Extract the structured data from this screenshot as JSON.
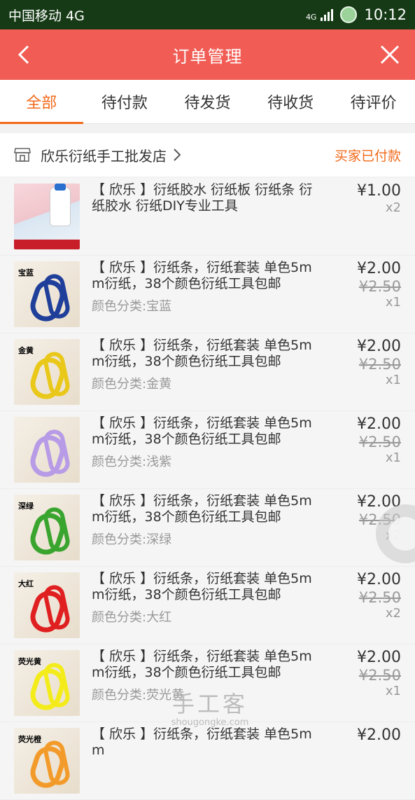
{
  "status_bar": {
    "carrier": "中国移动 4G",
    "network": "4G",
    "time": "10:12"
  },
  "title_bar": {
    "title": "订单管理",
    "back_icon": "chevron-left-icon",
    "close_icon": "close-icon"
  },
  "tabs": [
    {
      "label": "全部",
      "active": true
    },
    {
      "label": "待付款",
      "active": false
    },
    {
      "label": "待发货",
      "active": false
    },
    {
      "label": "待收货",
      "active": false
    },
    {
      "label": "待评价",
      "active": false
    }
  ],
  "shop": {
    "name": "欣乐衍纸手工批发店",
    "status": "买家已付款",
    "icon": "shop-icon"
  },
  "items": [
    {
      "title": "【 欣乐 】衍纸胶水 衍纸板 衍纸条 衍纸胶水 衍纸DIY专业工具",
      "variant": "",
      "price": "¥1.00",
      "old_price": "",
      "qty": "x2",
      "thumb_tag": "",
      "color": "#3b7bd0"
    },
    {
      "title": "【 欣乐 】衍纸条，衍纸套装 单色5mm衍纸，38个颜色衍纸工具包邮",
      "variant": "颜色分类:宝蓝",
      "price": "¥2.00",
      "old_price": "¥2.50",
      "qty": "x1",
      "thumb_tag": "宝蓝",
      "color": "#1f3f9a"
    },
    {
      "title": "【 欣乐 】衍纸条，衍纸套装 单色5mm衍纸，38个颜色衍纸工具包邮",
      "variant": "颜色分类:金黄",
      "price": "¥2.00",
      "old_price": "¥2.50",
      "qty": "x1",
      "thumb_tag": "金黄",
      "color": "#e9c81a"
    },
    {
      "title": "【 欣乐 】衍纸条，衍纸套装 单色5mm衍纸，38个颜色衍纸工具包邮",
      "variant": "颜色分类:浅紫",
      "price": "¥2.00",
      "old_price": "¥2.50",
      "qty": "x1",
      "thumb_tag": "",
      "color": "#b79be6"
    },
    {
      "title": "【 欣乐 】衍纸条，衍纸套装 单色5mm衍纸，38个颜色衍纸工具包邮",
      "variant": "颜色分类:深绿",
      "price": "¥2.00",
      "old_price": "¥2.50",
      "qty": "x2",
      "thumb_tag": "深绿",
      "color": "#3aa52e"
    },
    {
      "title": "【 欣乐 】衍纸条，衍纸套装 单色5mm衍纸，38个颜色衍纸工具包邮",
      "variant": "颜色分类:大红",
      "price": "¥2.00",
      "old_price": "¥2.50",
      "qty": "x2",
      "thumb_tag": "大红",
      "color": "#e02020"
    },
    {
      "title": "【 欣乐 】衍纸条，衍纸套装 单色5mm衍纸，38个颜色衍纸工具包邮",
      "variant": "颜色分类:荧光黄",
      "price": "¥2.00",
      "old_price": "¥2.50",
      "qty": "x1",
      "thumb_tag": "荧光黄",
      "color": "#f3ec1a"
    },
    {
      "title": "【 欣乐 】衍纸条，衍纸套装 单色5mm",
      "variant": "",
      "price": "¥2.00",
      "old_price": "",
      "qty": "",
      "thumb_tag": "荧光橙",
      "color": "#f29b2a"
    }
  ],
  "watermark": {
    "main": "手工客",
    "sub": "shougongke.com"
  },
  "colors": {
    "accent": "#f15d55",
    "tab_active": "#f26a1b",
    "status_bar": "#163a16"
  }
}
